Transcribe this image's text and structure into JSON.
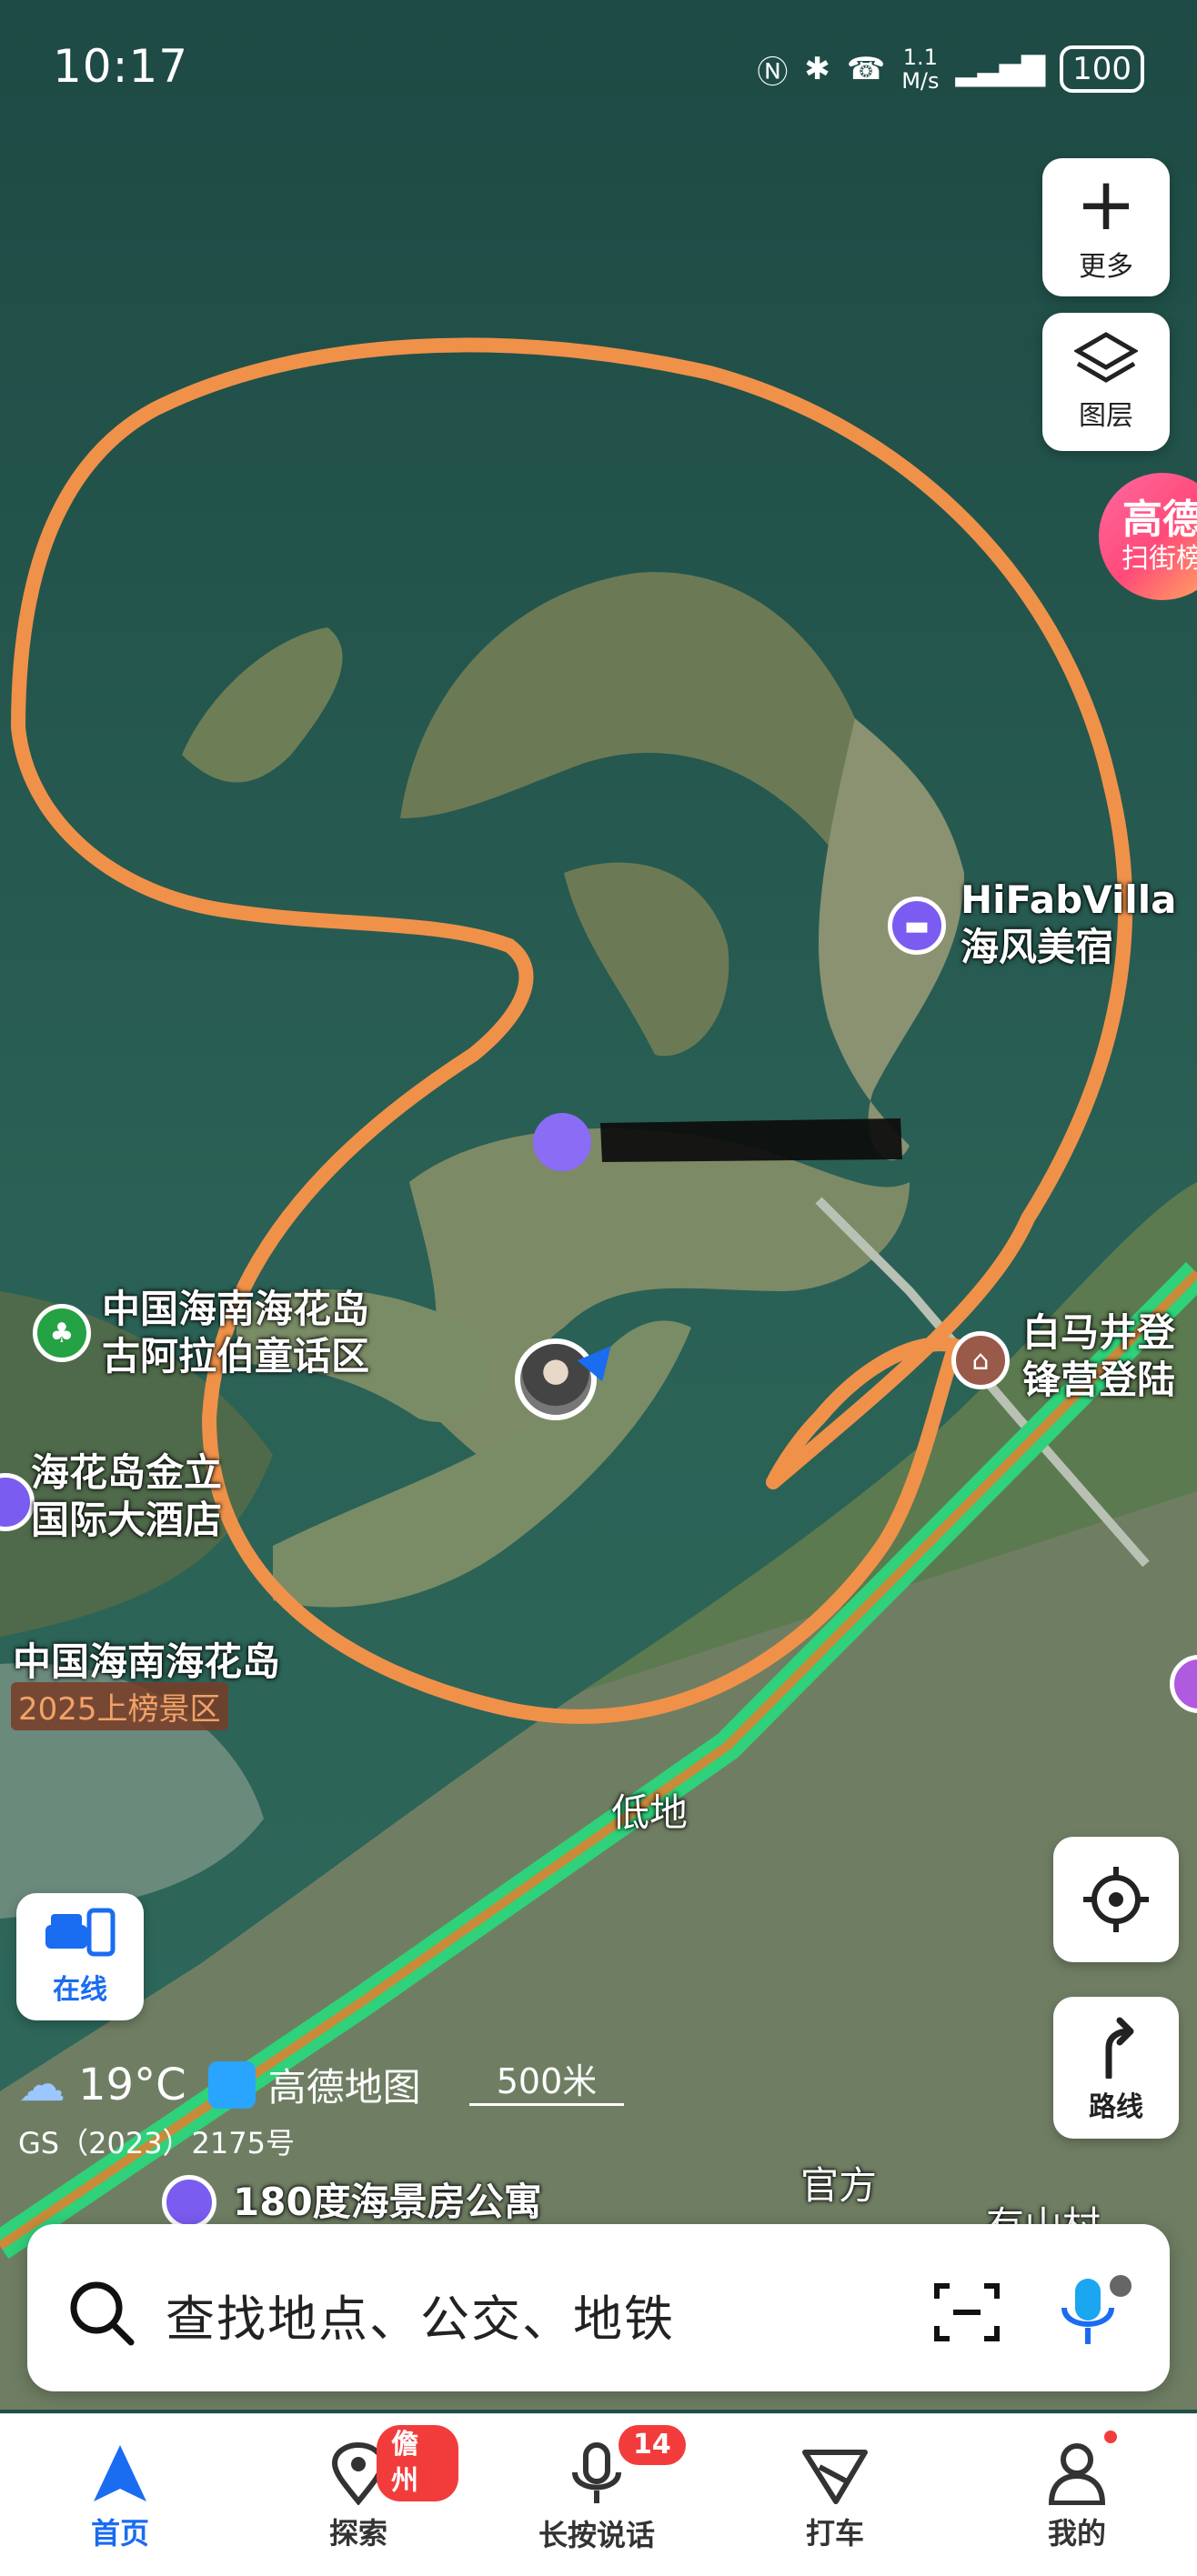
{
  "status_bar": {
    "time": "10:17",
    "net_speed_value": "1.1",
    "net_speed_unit": "M/s",
    "battery": "100"
  },
  "right_controls": {
    "more_label": "更多",
    "layers_label": "图层",
    "ranking_line1": "高德",
    "ranking_line2": "扫街榜"
  },
  "map_labels": {
    "hotel_villa": "HiFabVilla\n海风美宿",
    "fairy_tale": "中国海南海花岛\n古阿拉伯童话区",
    "baima": "白马井登\n锋营登陆",
    "jinli": "海花岛金立\n国际大酒店",
    "scenic_name": "中国海南海花岛",
    "scenic_badge": "2025上榜景区",
    "lowland": "低地",
    "guanfang": "官方",
    "seaview": "180度海景房公寓",
    "cut_label": "有山村"
  },
  "online_label": "在线",
  "locate_label": "",
  "route_label": "路线",
  "weather": {
    "temp": "19°C",
    "brand": "高德地图"
  },
  "scale": "500米",
  "license": "GS（2023）2175号",
  "search": {
    "placeholder": "查找地点、公交、地铁"
  },
  "tabs": [
    {
      "label": "首页",
      "active": true
    },
    {
      "label": "探索",
      "badge": "儋州"
    },
    {
      "label": "长按说话",
      "badge": "14"
    },
    {
      "label": "打车"
    },
    {
      "label": "我的"
    }
  ],
  "colors": {
    "accent": "#1a6cf0",
    "badge": "#f23c3c",
    "road": "#2fd17a",
    "annotation": "#f0914a"
  }
}
